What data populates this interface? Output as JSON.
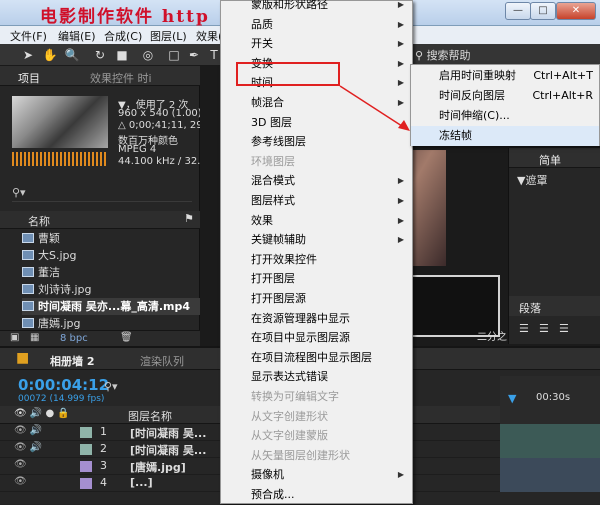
{
  "window": {
    "title": "电影制作软件 http",
    "min_label": "—",
    "max_label": "□",
    "close_label": "✕"
  },
  "menubar": [
    "文件(F)",
    "编辑(E)",
    "合成(C)",
    "图层(L)",
    "效果("
  ],
  "toolbar": {
    "search_help": "搜索帮助",
    "tool_icons": [
      "arrow-icon",
      "hand-icon",
      "zoom-icon",
      "rotate-icon",
      "camera-icon",
      "pan-icon",
      "rect-icon",
      "pen-icon",
      "text-icon"
    ]
  },
  "project_panel": {
    "tab_project": "项目",
    "tab_effects": "效果控件 时i",
    "info_lines": [
      "▼，使用了 2 次",
      "960 x 540 (1.00)",
      "△ 0;00;41;11, 29.97",
      "数百万种颜色",
      "MPEG 4",
      "44.100 kHz / 32..."
    ],
    "column_name": "名称",
    "files": [
      "曹颖",
      "大S.jpg",
      "董洁",
      "刘诗诗.jpg",
      "时间凝雨 吴亦...幕_高清.mp4",
      "唐嫣.jpg"
    ],
    "selected_index": 4,
    "bpc": "8 bpc"
  },
  "right_panel": {
    "tab_label": "简单",
    "mask_label": "▼遮罩",
    "align_tab": "段落",
    "indent_label": "二分之"
  },
  "timeline": {
    "tab_comp": "相册墙 2",
    "tab_render": "渲染队列",
    "timecode": "0:00:04:12",
    "fps": "00072 (14.999 fps)",
    "layer_header": "图层名称",
    "ruler_label": "00:30s",
    "layers": [
      {
        "num": "1",
        "name": "[时间凝雨 吴..."
      },
      {
        "num": "2",
        "name": "[时间凝雨 吴..."
      },
      {
        "num": "3",
        "name": "[唐嫣.jpg]"
      },
      {
        "num": "4",
        "name": "[...]"
      }
    ]
  },
  "context_menu": {
    "items": [
      {
        "label": "蒙版和形状路径",
        "arrow": true,
        "disabled": false
      },
      {
        "label": "品质",
        "arrow": true,
        "disabled": false
      },
      {
        "label": "开关",
        "arrow": true,
        "disabled": false
      },
      {
        "label": "变换",
        "arrow": true,
        "disabled": false
      },
      {
        "label": "时间",
        "arrow": true,
        "disabled": false
      },
      {
        "label": "帧混合",
        "arrow": true,
        "disabled": false
      },
      {
        "label": "3D 图层",
        "arrow": false,
        "disabled": false
      },
      {
        "label": "参考线图层",
        "arrow": false,
        "disabled": false
      },
      {
        "label": "环境图层",
        "arrow": false,
        "disabled": true
      },
      {
        "label": "混合模式",
        "arrow": true,
        "disabled": false
      },
      {
        "label": "图层样式",
        "arrow": true,
        "disabled": false
      },
      {
        "label": "效果",
        "arrow": true,
        "disabled": false
      },
      {
        "label": "关键帧辅助",
        "arrow": true,
        "disabled": false
      },
      {
        "label": "打开效果控件",
        "arrow": false,
        "disabled": false
      },
      {
        "label": "打开图层",
        "arrow": false,
        "disabled": false
      },
      {
        "label": "打开图层源",
        "arrow": false,
        "disabled": false
      },
      {
        "label": "在资源管理器中显示",
        "arrow": false,
        "disabled": false
      },
      {
        "label": "在项目中显示图层源",
        "arrow": false,
        "disabled": false
      },
      {
        "label": "在项目流程图中显示图层",
        "arrow": false,
        "disabled": false
      },
      {
        "label": "显示表达式错误",
        "arrow": false,
        "disabled": false
      },
      {
        "label": "转换为可编辑文字",
        "arrow": false,
        "disabled": true
      },
      {
        "label": "从文字创建形状",
        "arrow": false,
        "disabled": true
      },
      {
        "label": "从文字创建蒙版",
        "arrow": false,
        "disabled": true
      },
      {
        "label": "从矢量图层创建形状",
        "arrow": false,
        "disabled": true
      },
      {
        "label": "摄像机",
        "arrow": true,
        "disabled": false
      },
      {
        "label": "预合成...",
        "arrow": false,
        "disabled": false
      }
    ]
  },
  "submenu": {
    "items": [
      {
        "label": "启用时间重映射",
        "shortcut": "Ctrl+Alt+T"
      },
      {
        "label": "时间反向图层",
        "shortcut": "Ctrl+Alt+R"
      },
      {
        "label": "时间伸缩(C)...",
        "shortcut": ""
      },
      {
        "label": "冻结帧",
        "shortcut": ""
      }
    ]
  },
  "colors": {
    "highlight_box": "#e02020",
    "timecode": "#3aa0e8",
    "title_text": "#d0102a"
  }
}
